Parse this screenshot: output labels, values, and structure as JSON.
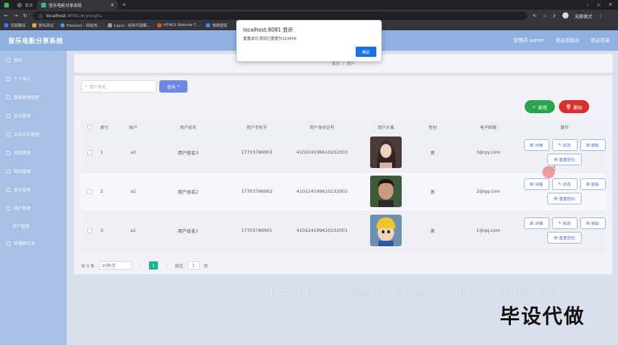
{
  "browser": {
    "tabs": [
      {
        "label": "首页",
        "active": false
      },
      {
        "label": "音乐电影分享系统",
        "active": true
      }
    ],
    "url_host": "localhost",
    "url_rest": ":8081/#/yonghu",
    "profile_label": "无痕模式",
    "bookmarks": [
      "百度翻译",
      "爱私网站",
      "Element - 网站快...",
      "Layui - 经典开源模...",
      "HTML5 Website T...",
      "搜索壁纸"
    ]
  },
  "header": {
    "title": "音乐电影分享系统",
    "user_label": "管理员 admin",
    "to_frontend": "退出到前台",
    "logout": "退出登录"
  },
  "sidebar": {
    "items": [
      {
        "label": "首页"
      },
      {
        "label": "个人中心"
      },
      {
        "label": "基础数据管理"
      },
      {
        "label": "论坛管理"
      },
      {
        "label": "公告信息管理"
      },
      {
        "label": "音频管理"
      },
      {
        "label": "视频管理"
      },
      {
        "label": "音乐管理"
      },
      {
        "label": "用户管理"
      }
    ],
    "sub_item": "用户管理",
    "last_item": "轮播图信息"
  },
  "breadcrumb": {
    "home": "首页",
    "sep": "/",
    "current": "用户"
  },
  "search": {
    "placeholder": "用户姓名",
    "button": "查询"
  },
  "actions": {
    "add": "新增",
    "delete": "删除"
  },
  "table": {
    "headers": [
      "索引",
      "账户",
      "用户姓名",
      "用户手机号",
      "用户身份证号",
      "用户头像",
      "性别",
      "电子邮箱",
      "操作"
    ],
    "rows": [
      {
        "index": "1",
        "account": "a3",
        "name": "用户姓名3",
        "phone": "17703786903",
        "idcard": "410224199610232003",
        "gender": "男",
        "email": "3@qq.com"
      },
      {
        "index": "2",
        "account": "a2",
        "name": "用户姓名2",
        "phone": "17703786902",
        "idcard": "410224199610232002",
        "gender": "男",
        "email": "2@qq.com"
      },
      {
        "index": "3",
        "account": "a1",
        "name": "用户姓名1",
        "phone": "17703786901",
        "idcard": "410224199610232001",
        "gender": "男",
        "email": "1@qq.com"
      }
    ],
    "op_labels": {
      "detail": "详情",
      "edit": "修改",
      "remove": "删除",
      "reset": "重置密码"
    }
  },
  "pagination": {
    "total": "共 3 条",
    "page_size": "10条/页",
    "current": "1",
    "goto_prefix": "前往",
    "goto_value": "1",
    "goto_suffix": "页"
  },
  "dialog": {
    "title": "localhost:8081 显示",
    "message": "重置成功,密码已重置为123456",
    "ok": "确定"
  },
  "watermark": {
    "url": "https://www.huzhan.com/ishop39397",
    "text": "毕设代做"
  },
  "colors": {
    "header": "#8fb0e0",
    "sidebar": "#a9c0e6",
    "primary": "#6d87e6",
    "add": "#2aa54f",
    "delete": "#d9302c",
    "pager_active": "#1bb394"
  }
}
